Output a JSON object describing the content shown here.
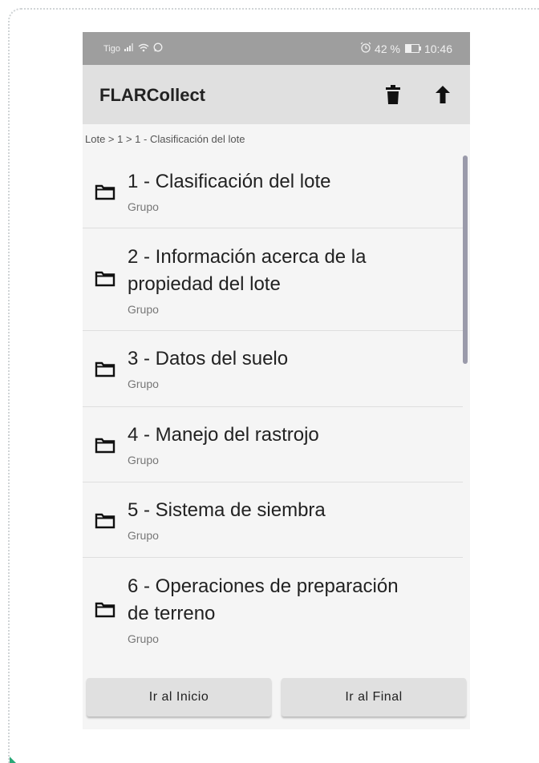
{
  "status_bar": {
    "carrier": "Tigo",
    "battery_pct": "42 %",
    "time": "10:46",
    "battery_level": 0.42
  },
  "app_bar": {
    "title": "FLARCollect",
    "icons": [
      "trash-icon",
      "upload-icon"
    ]
  },
  "breadcrumb": "Lote > 1 > 1 - Clasificación del lote",
  "items": [
    {
      "lines": [
        "1 - Clasificación del lote"
      ],
      "sub": "Grupo"
    },
    {
      "lines": [
        "2 - Información acerca de la",
        "propiedad del lote"
      ],
      "sub": "Grupo"
    },
    {
      "lines": [
        "3 - Datos del suelo"
      ],
      "sub": "Grupo"
    },
    {
      "lines": [
        "4 - Manejo del rastrojo"
      ],
      "sub": "Grupo"
    },
    {
      "lines": [
        "5 - Sistema de siembra"
      ],
      "sub": "Grupo"
    },
    {
      "lines": [
        "6 - Operaciones de preparación",
        "de terreno"
      ],
      "sub": "Grupo"
    }
  ],
  "buttons": {
    "start": "Ir al Inicio",
    "end": "Ir al Final"
  },
  "colors": {
    "status_bar": "#9e9e9e",
    "app_bar": "#e0e0e0",
    "background": "#f5f5f5",
    "scrollbar": "#9a9aaa"
  }
}
